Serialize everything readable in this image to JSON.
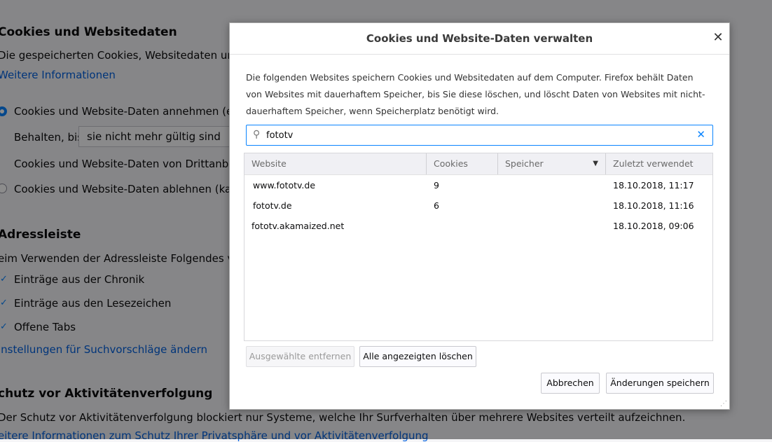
{
  "background": {
    "cookies_heading": "Cookies und Websitedaten",
    "cookies_desc": "Die gespeicherten Cookies, Websitedaten und der C",
    "more_info_link": "Weitere Informationen",
    "accept_radio": "Cookies und Website-Daten annehmen (empfo",
    "keep_label": "Behalten, bis",
    "keep_select": "sie nicht mehr gültig sind",
    "third_party": "Cookies und Website-Daten von Drittanbietern",
    "reject_radio": "Cookies und Website-Daten ablehnen (kann Pr",
    "address_heading": "Adressleiste",
    "address_desc": "eim Verwenden der Adressleiste Folgendes vorsch",
    "check_history": "Einträge aus der Chronik",
    "check_bookmarks": "Einträge aus den Lesezeichen",
    "check_tabs": "Offene Tabs",
    "suggest_link": "instellungen für Suchvorschläge ändern",
    "tracking_heading": "chutz vor Aktivitätenverfolgung",
    "tracking_desc": "Der Schutz vor Aktivitätenverfolgung blockiert nur Systeme, welche Ihr Surfverhalten über mehrere Websites verteilt aufzeichnen.",
    "tracking_link": "eitere Informationen zum Schutz Ihrer Privatsphäre und vor Aktivitätenverfolgung"
  },
  "dialog": {
    "title": "Cookies und Website-Daten verwalten",
    "close_glyph": "✕",
    "description": "Die folgenden Websites speichern Cookies und Websitedaten auf dem Computer. Firefox behält Daten von Websites mit dauerhaftem Speicher, bis Sie diese löschen, und löscht Daten von Websites mit nicht-dauerhaftem Speicher, wenn Speicherplatz benötigt wird.",
    "search_value": "fototv",
    "search_icon": "search-icon",
    "columns": {
      "website": "Website",
      "cookies": "Cookies",
      "storage": "Speicher",
      "last_used": "Zuletzt verwendet"
    },
    "sort_indicator": "▼",
    "rows": [
      {
        "website": "www.fototv.de",
        "cookies": "9",
        "storage": "",
        "last_used": "18.10.2018, 11:17"
      },
      {
        "website": "fototv.de",
        "cookies": "6",
        "storage": "",
        "last_used": "18.10.2018, 11:16"
      },
      {
        "website": "fototv.akamaized.net",
        "cookies": "",
        "storage": "",
        "last_used": "18.10.2018, 09:06"
      }
    ],
    "remove_selected_label": "Ausgewählte entfernen",
    "remove_all_label": "Alle angezeigten löschen",
    "cancel_label": "Abbrechen",
    "save_label": "Änderungen speichern"
  },
  "colors": {
    "accent": "#0a84ff",
    "link": "#0060df",
    "overlay": "rgba(0,0,0,0.45)"
  }
}
